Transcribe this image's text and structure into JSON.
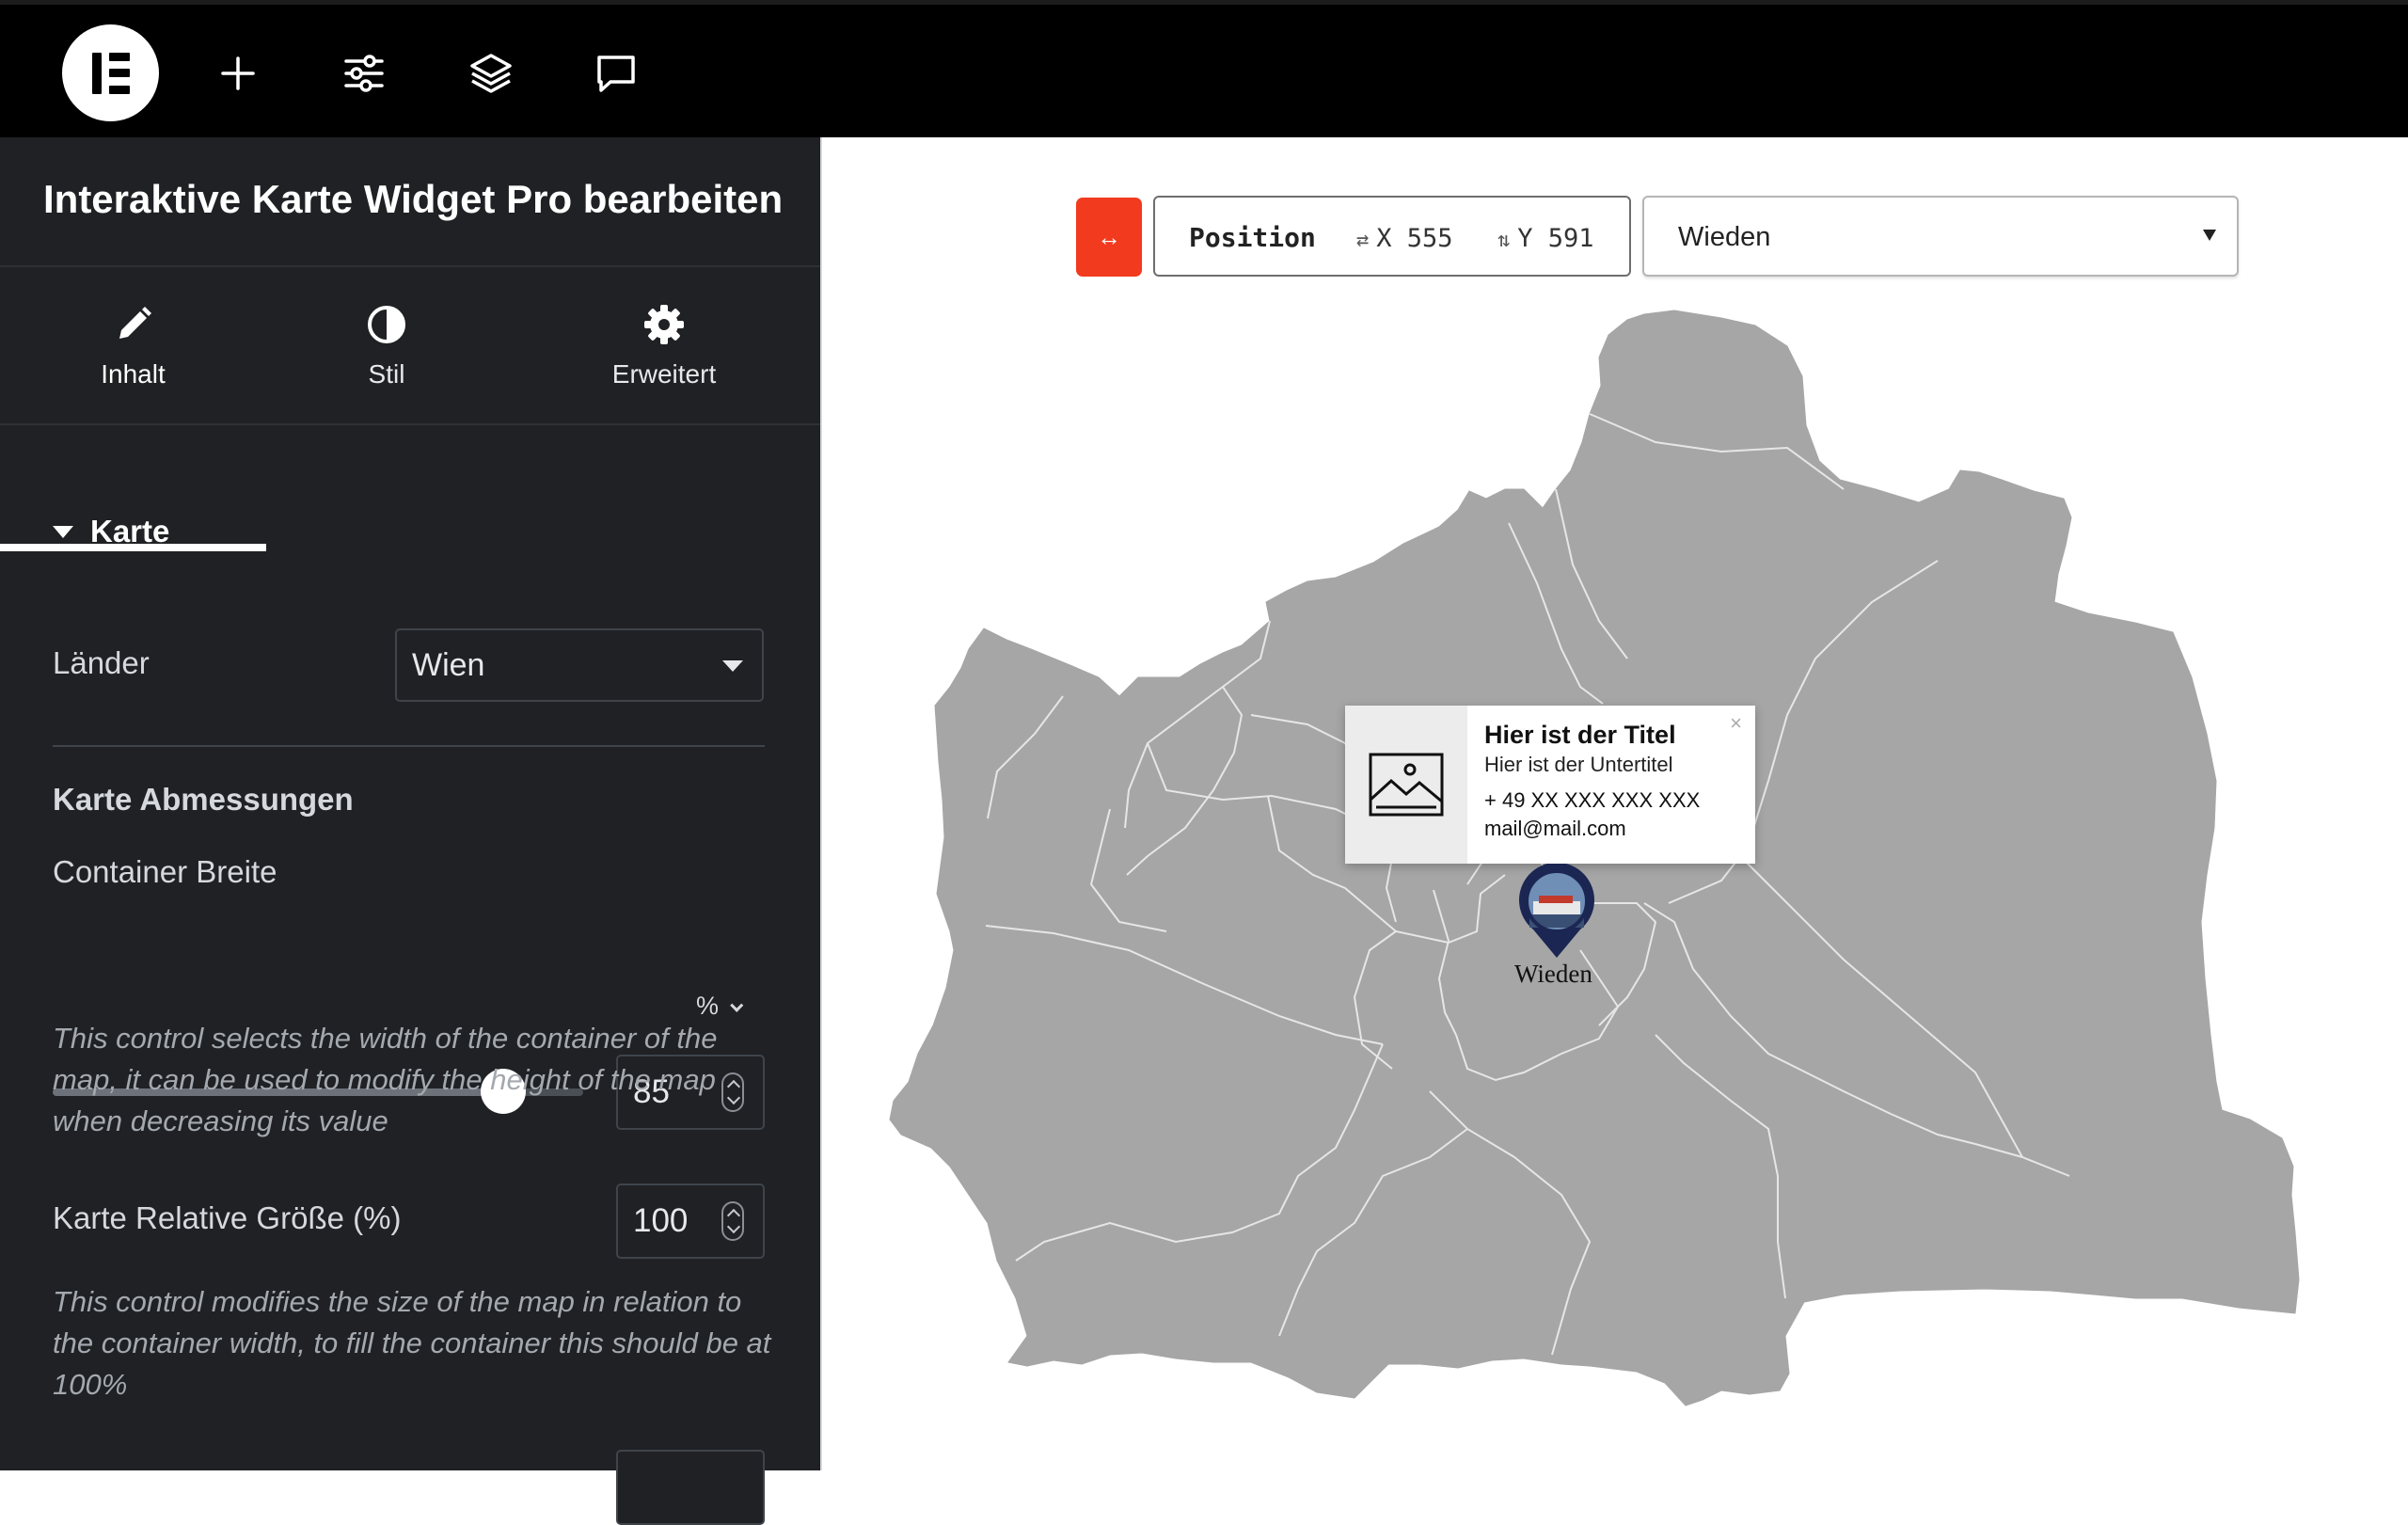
{
  "topbar": {
    "icons": [
      "elementor-logo-icon",
      "plus-icon",
      "sliders-icon",
      "layers-icon",
      "chat-icon"
    ]
  },
  "panel": {
    "title": "Interaktive Karte Widget Pro bearbeiten",
    "tabs": [
      {
        "label": "Inhalt",
        "icon": "pencil-icon",
        "active": true
      },
      {
        "label": "Stil",
        "icon": "contrast-icon",
        "active": false
      },
      {
        "label": "Erweitert",
        "icon": "gear-icon",
        "active": false
      }
    ],
    "section": "Karte",
    "laender_label": "Länder",
    "laender_value": "Wien",
    "dimensions_heading": "Karte Abmessungen",
    "container_width_label": "Container Breite",
    "container_width_unit": "%",
    "container_width_value": "85",
    "container_width_fraction": 0.85,
    "container_width_help": "This control selects the width of the container of the map, it can be used to modify the height of the map when decreasing its value",
    "relative_size_label": "Karte Relative Größe (%)",
    "relative_size_value": "100",
    "relative_size_help": "This control modifies the size of the map in relation to the container width, to fill the container this should be at 100%"
  },
  "toolbar": {
    "toggle_icon": "↔",
    "position_label": "Position",
    "x_icon": "⇄",
    "x_text": "X 555",
    "y_icon": "⇅",
    "y_text": "Y 591",
    "region_selected": "Wieden"
  },
  "popup": {
    "title": "Hier ist der Titel",
    "subtitle": "Hier ist der Untertitel",
    "phone": "+ 49 XX XXX XXX XXX",
    "email": "mail@mail.com",
    "close": "×"
  },
  "marker": {
    "label": "Wieden"
  },
  "colors": {
    "accent": "#f23a1f",
    "map_fill": "#a6a6a6",
    "map_border": "#e4e4e4",
    "pin": "#1b2652",
    "sidebar_bg": "#1f2124"
  }
}
